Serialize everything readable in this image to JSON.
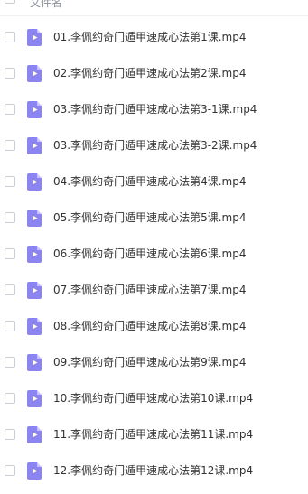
{
  "header": {
    "column_label": "文件名"
  },
  "files": [
    {
      "name": "01.李佩约奇门遁甲速成心法第1课.mp4"
    },
    {
      "name": "02.李佩约奇门遁甲速成心法第2课.mp4"
    },
    {
      "name": "03.李佩约奇门遁甲速成心法第3-1课.mp4"
    },
    {
      "name": "03.李佩约奇门遁甲速成心法第3-2课.mp4"
    },
    {
      "name": "04.李佩约奇门遁甲速成心法第4课.mp4"
    },
    {
      "name": "05.李佩约奇门遁甲速成心法第5课.mp4"
    },
    {
      "name": "06.李佩约奇门遁甲速成心法第6课.mp4"
    },
    {
      "name": "07.李佩约奇门遁甲速成心法第7课.mp4"
    },
    {
      "name": "08.李佩约奇门遁甲速成心法第8课.mp4"
    },
    {
      "name": "09.李佩约奇门遁甲速成心法第9课.mp4"
    },
    {
      "name": "10.李佩约奇门遁甲速成心法第10课.mp4"
    },
    {
      "name": "11.李佩约奇门遁甲速成心法第11课.mp4"
    },
    {
      "name": "12.李佩约奇门遁甲速成心法第12课.mp4"
    }
  ],
  "icons": {
    "file_type": "video-file-icon",
    "file_color": "#8c85f0",
    "play_color": "#ffffff"
  }
}
